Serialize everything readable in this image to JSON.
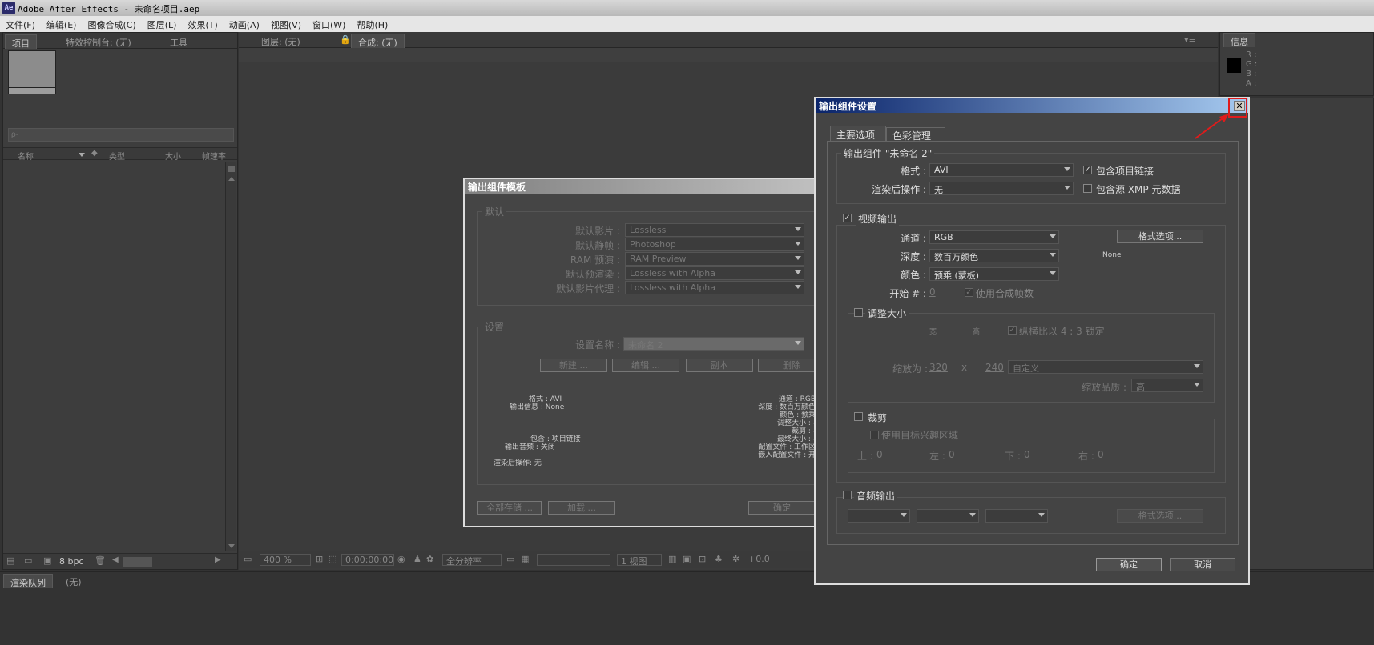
{
  "window": {
    "title": "Adobe After Effects - 未命名项目.aep",
    "app_badge": "Ae"
  },
  "menu": [
    "文件(F)",
    "编辑(E)",
    "图像合成(C)",
    "图层(L)",
    "效果(T)",
    "动画(A)",
    "视图(V)",
    "窗口(W)",
    "帮助(H)"
  ],
  "left_panel": {
    "tabs": [
      "项目",
      "特效控制台: (无)",
      "工具"
    ],
    "search_placeholder": "ρ-",
    "columns": [
      "名称",
      "类型",
      "大小",
      "帧速率"
    ],
    "bpc": "8 bpc"
  },
  "viewer": {
    "tabs": [
      "图层: (无)",
      "合成: (无)"
    ],
    "zoom": "400 %",
    "timecode": "0:00:00:00",
    "resolution": "全分辨率",
    "views": "1 视图",
    "exposure": "+0.0"
  },
  "info_panel": {
    "tab": "信息",
    "channels": [
      "R :",
      "G :",
      "B :",
      "A :"
    ]
  },
  "bottom": {
    "tabs": [
      "渲染队列",
      "(无)"
    ]
  },
  "template_dialog": {
    "title": "输出组件模板",
    "default_group": "默认",
    "rows": [
      {
        "label": "默认影片 :",
        "value": "Lossless"
      },
      {
        "label": "默认静帧 :",
        "value": "Photoshop"
      },
      {
        "label": "RAM 预演 :",
        "value": "RAM Preview"
      },
      {
        "label": "默认预渲染 :",
        "value": "Lossless with Alpha"
      },
      {
        "label": "默认影片代理 :",
        "value": "Lossless with Alpha"
      }
    ],
    "settings_group": "设置",
    "settings_name_label": "设置名称 :",
    "settings_name_value": "未命名 2",
    "buttons": [
      "新建 ...",
      "编辑 ...",
      "副本",
      "删除"
    ],
    "summary_left": [
      "格式 : AVI",
      "输出信息 : None",
      "包含 : 项目链接",
      "输出音频 : 关闭",
      "渲染后操作: 无"
    ],
    "summary_right": [
      "通道 : RGB",
      "深度 : 数百万颜色",
      "颜色 : 预乘",
      "调整大小 : -",
      "裁剪 : -",
      "最终大小 : -",
      "配置文件 : 工作区",
      "嵌入配置文件 : 开"
    ],
    "bottom_buttons": [
      "全部存储 ...",
      "加载 ...",
      "确定"
    ]
  },
  "output_dialog": {
    "title": "输出组件设置",
    "tabs": [
      "主要选项",
      "色彩管理"
    ],
    "module_group": "输出组件 \"未命名 2\"",
    "format_label": "格式 :",
    "format_value": "AVI",
    "post_render_label": "渲染后操作 :",
    "post_render_value": "无",
    "include_project_link": "包含项目链接",
    "include_xmp": "包含源 XMP 元数据",
    "video_output": "视频输出",
    "channel_label": "通道 :",
    "channel_value": "RGB",
    "depth_label": "深度 :",
    "depth_value": "数百万颜色",
    "color_label": "颜色 :",
    "color_value": "预乘 (蒙板)",
    "start_label": "开始 # :",
    "start_value": "0",
    "use_comp_frame": "使用合成帧数",
    "format_options": "格式选项...",
    "codec_info": "None",
    "resize": "调整大小",
    "width_label": "宽",
    "height_label": "高",
    "lock_aspect": "纵横比以 4 : 3 锁定",
    "resize_to_label": "缩放为 :",
    "resize_w": "320",
    "resize_x": "x",
    "resize_h": "240",
    "resize_preset": "自定义",
    "resize_quality_label": "缩放品质 :",
    "resize_quality_value": "高",
    "crop": "裁剪",
    "use_roi": "使用目标兴趣区域",
    "crop_fields": [
      {
        "label": "上 :",
        "value": "0"
      },
      {
        "label": "左 :",
        "value": "0"
      },
      {
        "label": "下 :",
        "value": "0"
      },
      {
        "label": "右 :",
        "value": "0"
      }
    ],
    "audio_output": "音频输出",
    "audio_format_options": "格式选项...",
    "ok": "确定",
    "cancel": "取消"
  },
  "colors": {
    "highlight_red": "#e01b1b",
    "title_blue": "#0a246a"
  }
}
